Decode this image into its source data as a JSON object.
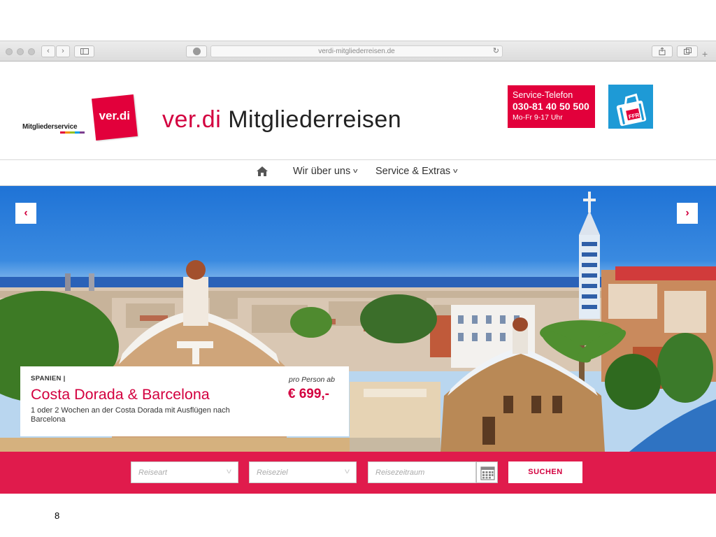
{
  "browser": {
    "url": "verdi-mitgliederreisen.de"
  },
  "header": {
    "mitgliederservice": "Mitgliederservice",
    "verdi_logo": "ver.di",
    "brand_prefix": "ver.di",
    "brand_suffix": " Mitgliederreisen",
    "service_label": "Service-Telefon",
    "service_phone": "030-81 40 50 500",
    "service_hours": "Mo-Fr 9-17 Uhr",
    "ffr_label": "FFR"
  },
  "nav": {
    "items": [
      {
        "label": "Wir über uns"
      },
      {
        "label": "Service & Extras"
      }
    ]
  },
  "hero": {
    "country": "SPANIEN |",
    "title": "Costa Dorada & Barcelona",
    "description": "1 oder 2 Wochen an der Costa Dorada mit Ausflügen nach Barcelona",
    "price_prefix": "pro Person ab",
    "price": "€ 699,-"
  },
  "search": {
    "travel_type_placeholder": "Reiseart",
    "destination_placeholder": "Reiseziel",
    "period_placeholder": "Reisezeitraum",
    "submit_label": "SUCHEN"
  },
  "footer": {
    "slide_number": "8"
  },
  "colors": {
    "brand_red": "#e2003b",
    "band_red": "#e01b4c",
    "sky_blue": "#1f73d6"
  }
}
